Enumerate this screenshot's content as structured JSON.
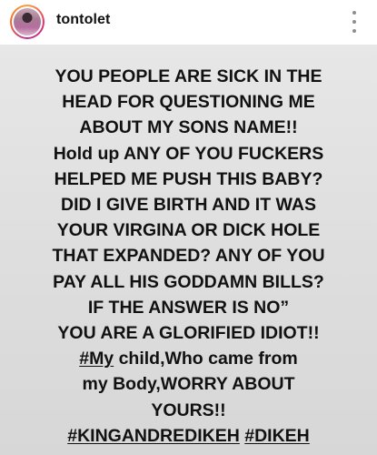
{
  "header": {
    "username": "tontolet",
    "avatar_icon": "profile-avatar",
    "more_icon": "more-options-vertical-icon"
  },
  "post": {
    "background_color": "#e2e2e2",
    "text_color": "#111111",
    "lines": [
      "YOU PEOPLE ARE SICK IN THE",
      "HEAD FOR QUESTIONING ME",
      "ABOUT MY SONS NAME!!",
      "Hold up ANY OF YOU FUCKERS",
      "HELPED ME PUSH THIS BABY?",
      "DID I GIVE BIRTH AND IT WAS",
      "YOUR VIRGINA OR DICK HOLE",
      "THAT EXPANDED? ANY OF YOU",
      "PAY ALL HIS GODDAMN BILLS?",
      "IF THE ANSWER IS NO”",
      "YOU ARE A GLORIFIED IDIOT!!"
    ],
    "line12": {
      "hashtag": "#My",
      "rest": " child,Who came from"
    },
    "line13": "my Body,WORRY ABOUT",
    "line14": "YOURS!!",
    "line15": {
      "hashtag1": "#KINGANDREDIKEH",
      "space": " ",
      "hashtag2": "#DIKEH"
    }
  }
}
